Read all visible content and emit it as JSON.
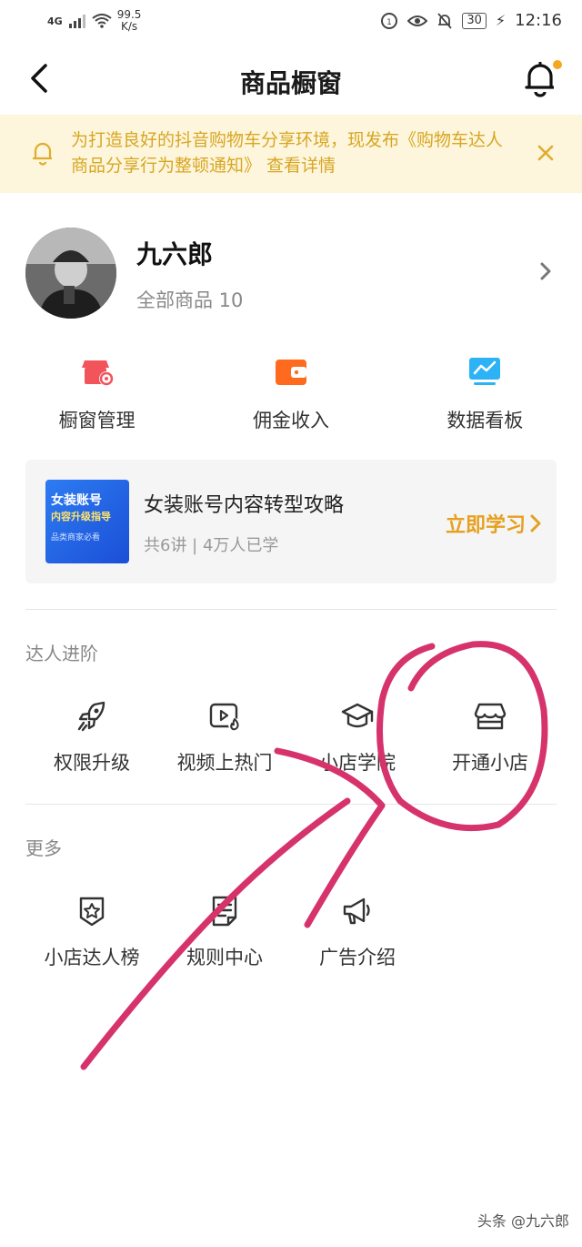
{
  "status_bar": {
    "network": "4G",
    "speed_value": "99.5",
    "speed_unit": "K/s",
    "battery": "30",
    "time": "12:16"
  },
  "nav": {
    "title": "商品橱窗"
  },
  "notice": {
    "text": "为打造良好的抖音购物车分享环境，现发布《购物车达人商品分享行为整顿通知》 查看详情"
  },
  "profile": {
    "name": "九六郎",
    "goods_count": "全部商品 10"
  },
  "tools": [
    {
      "label": "橱窗管理",
      "icon": "storefront-gear-icon",
      "color": "#f2545b"
    },
    {
      "label": "佣金收入",
      "icon": "wallet-icon",
      "color": "#ff6a1f"
    },
    {
      "label": "数据看板",
      "icon": "dashboard-icon",
      "color": "#2db3f5"
    }
  ],
  "course": {
    "cover_line1": "女装账号",
    "cover_line2": "内容升级指导",
    "cover_line3": "品类商家必看",
    "title": "女装账号内容转型攻略",
    "meta": "共6讲 | 4万人已学",
    "cta": "立即学习"
  },
  "sections": {
    "advance": {
      "title": "达人进阶",
      "items": [
        {
          "label": "权限升级",
          "icon": "rocket-icon"
        },
        {
          "label": "视频上热门",
          "icon": "video-hot-icon"
        },
        {
          "label": "小店学院",
          "icon": "graduation-cap-icon"
        },
        {
          "label": "开通小店",
          "icon": "shop-icon"
        }
      ]
    },
    "more": {
      "title": "更多",
      "items": [
        {
          "label": "小店达人榜",
          "icon": "star-badge-icon"
        },
        {
          "label": "规则中心",
          "icon": "rules-doc-icon"
        },
        {
          "label": "广告介绍",
          "icon": "megaphone-icon"
        }
      ]
    }
  },
  "annotation_color": "#d6336c",
  "watermark": "头条 @九六郎"
}
